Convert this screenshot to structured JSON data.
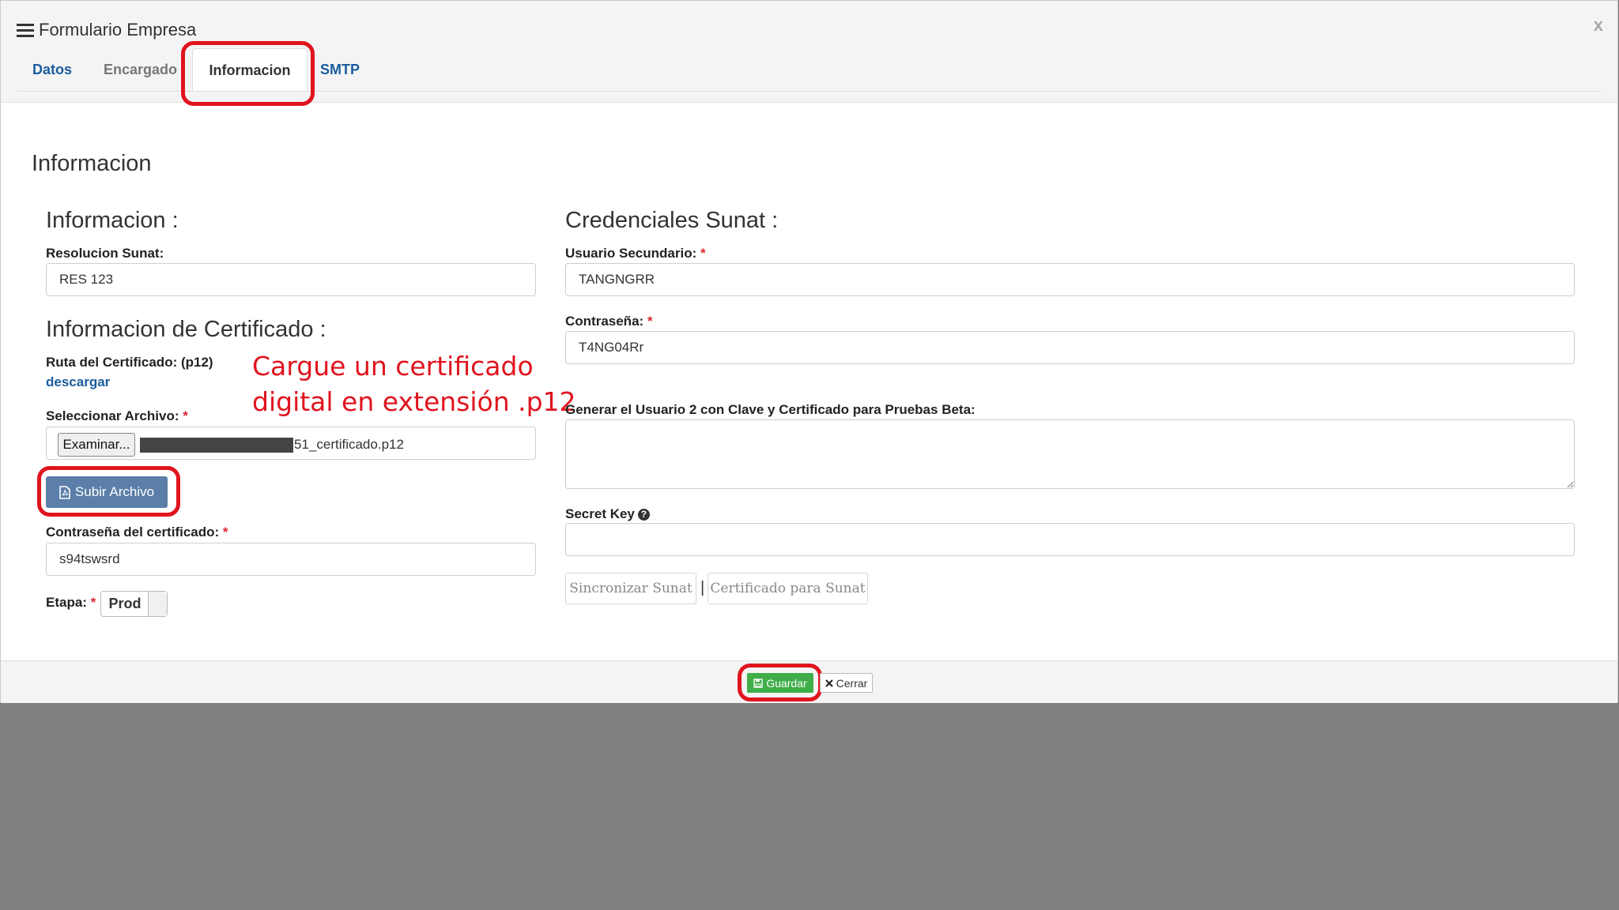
{
  "modal": {
    "title": "Formulario Empresa",
    "close_label": "x"
  },
  "tabs": [
    {
      "label": "Datos"
    },
    {
      "label": "Encargado"
    },
    {
      "label": "Informacion"
    },
    {
      "label": "SMTP"
    }
  ],
  "section_title": "Informacion",
  "left": {
    "heading_info": "Informacion :",
    "resolucion_label": "Resolucion Sunat:",
    "resolucion_value": "RES 123",
    "heading_cert": "Informacion de Certificado :",
    "ruta_label": "Ruta del Certificado: (p12)",
    "descargar_link": "descargar",
    "seleccionar_label": "Seleccionar Archivo:",
    "examinar_label": "Examinar...",
    "file_name": "51_certificado.p12",
    "subir_label": "Subir Archivo",
    "cert_password_label": "Contraseña del certificado:",
    "cert_password_value": "s94tswsrd",
    "etapa_label": "Etapa:",
    "etapa_value": "Prod"
  },
  "right": {
    "heading": "Credenciales Sunat :",
    "usuario_label": "Usuario Secundario:",
    "usuario_value": "TANGNGRR",
    "password_label": "Contraseña:",
    "password_value": "T4NG04Rr",
    "generar_label": "Generar el Usuario 2 con Clave y Certificado para Pruebas Beta:",
    "generar_value": "",
    "secret_label": "Secret Key",
    "secret_value": "",
    "sincronizar_label": "Sincronizar Sunat",
    "separator": "|",
    "certificado_label": "Certificado para Sunat"
  },
  "annotation": {
    "line1": "Cargue un certificado",
    "line2": "digital en extensión .p12"
  },
  "footer": {
    "save_label": "Guardar",
    "close_label": "Cerrar"
  },
  "colors": {
    "highlight": "#e0141e",
    "link_blue": "#1a5c9e",
    "save_green": "#3fae49",
    "upload_blue": "#5b7fa8",
    "backdrop": "#808080"
  },
  "icons": [
    "menu-icon",
    "file-pdf-icon",
    "question-circle-icon",
    "save-icon",
    "times-icon"
  ]
}
